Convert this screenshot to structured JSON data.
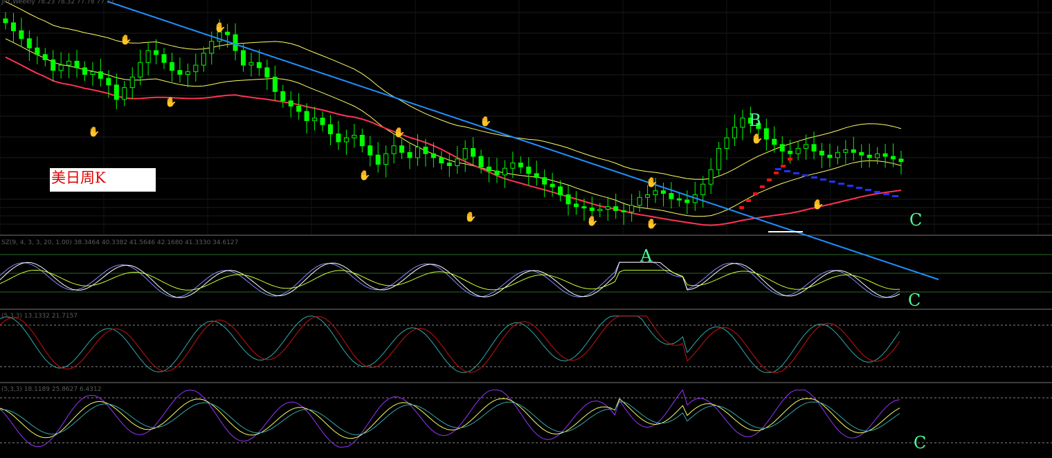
{
  "chart_data": {
    "type": "candlestick",
    "title": "美日周K",
    "header_main": "JPY,Weekly  78.23 78.32 77.78 77.77",
    "header_ind1": "SZ(9, 4, 3, 3, 20, 1.00) 38.3464 40.3382 41.5646 42.1680 41.3330 34.6127",
    "header_ind2": "(5,3,3) 13.1332 21.7157",
    "header_ind3": "(5,3,3) 18.1189 25.8627 6.4312",
    "wave_labels": {
      "a": "A",
      "b": "B",
      "c1": "C",
      "c2": "C",
      "c3": "C"
    },
    "grid": true,
    "colors": {
      "background": "#000000",
      "bull": "#00ff00",
      "bear": "#00ff00",
      "ma_fast": "#ffff66",
      "ma_slow": "#ff3355",
      "trendline": "#1e90ff",
      "wave_label": "#4cff9c",
      "fractal_up": "#cc2222",
      "fractal_down": "#3355ff",
      "stoch_k": "#33aaaa",
      "stoch_d": "#cc1111",
      "osc_main": "#9933ff",
      "osc_signal": "#ffff66",
      "osc_extra": "#33aaaa"
    },
    "price_closes": [
      86.8,
      86.2,
      85.6,
      84.9,
      84.4,
      84.0,
      83.2,
      83.6,
      83.9,
      83.4,
      82.9,
      83.1,
      82.6,
      82.1,
      81.0,
      81.9,
      82.7,
      83.8,
      84.7,
      84.4,
      83.8,
      83.2,
      82.9,
      83.1,
      83.6,
      84.5,
      85.4,
      86.1,
      85.9,
      84.7,
      83.6,
      83.8,
      83.4,
      82.7,
      81.6,
      80.9,
      80.5,
      80.1,
      79.4,
      79.6,
      79.1,
      78.4,
      77.8,
      78.1,
      78.3,
      77.5,
      76.8,
      76.1,
      76.9,
      77.5,
      77.0,
      76.6,
      77.4,
      76.9,
      76.6,
      76.2,
      76.0,
      76.5,
      77.3,
      76.7,
      75.9,
      75.6,
      75.3,
      75.8,
      76.2,
      75.9,
      75.4,
      75.1,
      74.6,
      74.4,
      73.8,
      73.1,
      72.9,
      72.8,
      72.6,
      72.7,
      72.9,
      72.6,
      72.5,
      73.0,
      73.6,
      73.8,
      74.1,
      73.9,
      73.5,
      73.4,
      73.2,
      73.8,
      74.6,
      75.7,
      77.3,
      78.1,
      78.9,
      79.6,
      79.2,
      78.8,
      78.0,
      77.6,
      77.1,
      76.9,
      77.3,
      77.6,
      77.1,
      76.8,
      76.6,
      77.0,
      77.2,
      77.0,
      76.8,
      76.6,
      76.9,
      76.7,
      76.5,
      76.3
    ]
  }
}
